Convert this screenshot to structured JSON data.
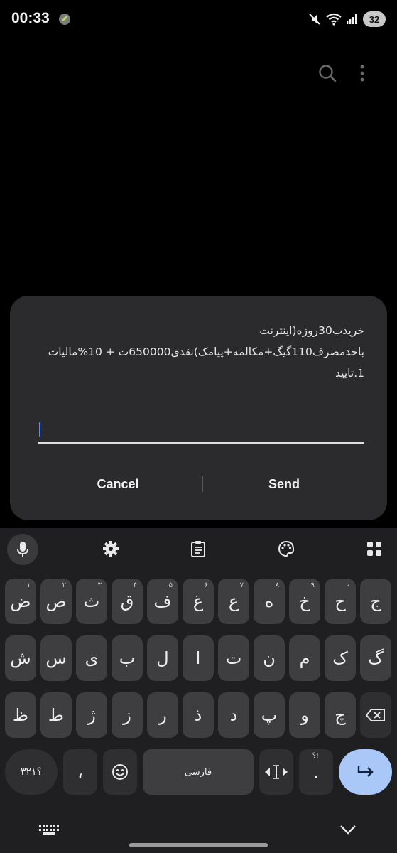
{
  "status_bar": {
    "time": "00:33",
    "battery": "32",
    "icons": [
      "mute-icon",
      "wifi-icon",
      "signal-icon",
      "battery-icon"
    ]
  },
  "app_bar": {
    "icons": [
      "search-icon",
      "more-vert-icon"
    ]
  },
  "dialog": {
    "message_lines": [
      "خریدب30روزه(اینترنت",
      "باحدمصرف110گیگ+مکالمه+پیامک)نقدی650000ت + 10%مالیات",
      "1.تایید"
    ],
    "input_value": "",
    "cancel_label": "Cancel",
    "send_label": "Send"
  },
  "keyboard": {
    "toolbar_icons": [
      "mic-icon",
      "settings-icon",
      "clipboard-icon",
      "palette-icon",
      "apps-grid-icon"
    ],
    "row1": [
      {
        "label": "ض",
        "hint": "۱"
      },
      {
        "label": "ص",
        "hint": "۲"
      },
      {
        "label": "ث",
        "hint": "۳"
      },
      {
        "label": "ق",
        "hint": "۴"
      },
      {
        "label": "ف",
        "hint": "۵"
      },
      {
        "label": "غ",
        "hint": "۶"
      },
      {
        "label": "ع",
        "hint": "۷"
      },
      {
        "label": "ه",
        "hint": "۸"
      },
      {
        "label": "خ",
        "hint": "۹"
      },
      {
        "label": "ح",
        "hint": "۰"
      },
      {
        "label": "ج",
        "hint": ""
      }
    ],
    "row2": [
      "ش",
      "س",
      "ی",
      "ب",
      "ل",
      "ا",
      "ت",
      "ن",
      "م",
      "ک",
      "گ"
    ],
    "row3": [
      "ظ",
      "ط",
      "ژ",
      "ز",
      "ر",
      "ذ",
      "د",
      "پ",
      "و",
      "چ"
    ],
    "symbols_label": "؟۳۲۱",
    "comma_label": "،",
    "space_label": "فارسی",
    "period_label": ".",
    "period_hint": "؟!",
    "accent_color": "#a9c7f7"
  }
}
